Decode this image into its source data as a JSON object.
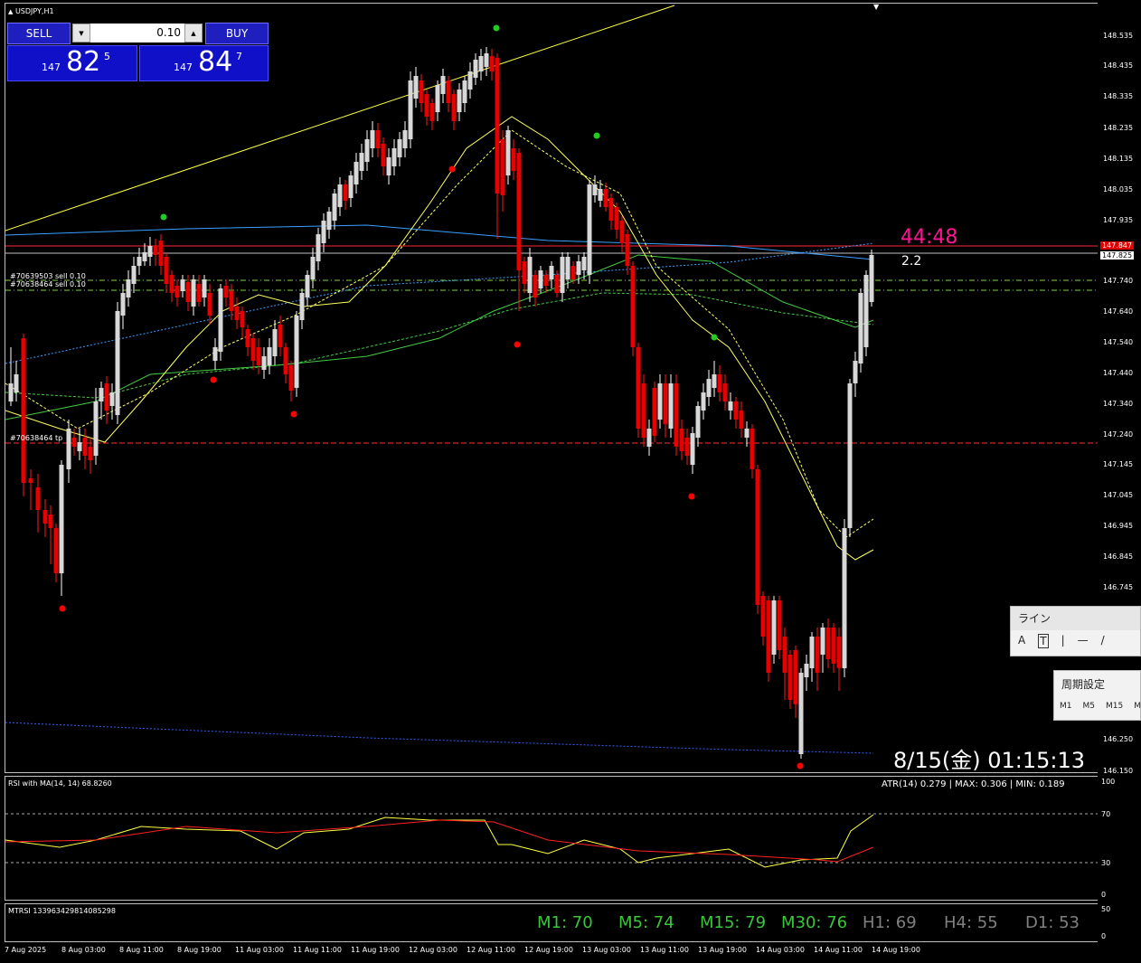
{
  "chart_title": "USDJPY,H1",
  "trade_panel": {
    "sell_label": "SELL",
    "buy_label": "BUY",
    "lot": "0.10",
    "sell_price_prefix": "147",
    "sell_price_big": "82",
    "sell_price_sup": "5",
    "buy_price_prefix": "147",
    "buy_price_big": "84",
    "buy_price_sup": "7"
  },
  "price_axis": [
    "148.535",
    "148.435",
    "148.335",
    "148.235",
    "148.135",
    "148.035",
    "147.935",
    "147.825",
    "147.740",
    "147.640",
    "147.540",
    "147.440",
    "147.340",
    "147.240",
    "147.145",
    "147.045",
    "146.945",
    "146.845",
    "146.745",
    "146.250",
    "146.150"
  ],
  "current_price_label": "147.825",
  "red_price_label": "147.847",
  "orders": {
    "sell1": "#70639503 sell 0.10",
    "sell2": "#70638464 sell 0.10",
    "tp": "#70638464 tp"
  },
  "countdown": "44:48",
  "spread": "2.2",
  "datetime": "8/15(金) 01:15:13",
  "rsi_panel": {
    "title": "RSI with MA(14, 14) 68.8260",
    "atr": "ATR(14) 0.279 | MAX: 0.306 | MIN: 0.189",
    "levels": [
      "100",
      "70",
      "30",
      "0"
    ]
  },
  "mtrsi_panel": {
    "title": "MTRSI 1339634298140852​98",
    "levels": [
      "50",
      "0"
    ],
    "items": [
      {
        "label": "M1: 70",
        "color": "#39c639"
      },
      {
        "label": "M5: 74",
        "color": "#39c639"
      },
      {
        "label": "M15: 79",
        "color": "#39c639"
      },
      {
        "label": "M30: 76",
        "color": "#39c639"
      },
      {
        "label": "H1: 69",
        "color": "#808080"
      },
      {
        "label": "H4: 55",
        "color": "#808080"
      },
      {
        "label": "D1: 53",
        "color": "#808080"
      }
    ]
  },
  "time_axis": [
    "7 Aug 2025",
    "8 Aug 03:00",
    "8 Aug 11:00",
    "8 Aug 19:00",
    "11 Aug 03:00",
    "11 Aug 11:00",
    "11 Aug 19:00",
    "12 Aug 03:00",
    "12 Aug 11:00",
    "12 Aug 19:00",
    "13 Aug 03:00",
    "13 Aug 11:00",
    "13 Aug 19:00",
    "14 Aug 03:00",
    "14 Aug 11:00",
    "14 Aug 19:00"
  ],
  "line_popup": {
    "title": "ライン",
    "tools": [
      "A",
      "T",
      "|",
      "—",
      "/"
    ]
  },
  "period_popup": {
    "title": "周期設定",
    "items": [
      "M1",
      "M5",
      "M15",
      "M"
    ]
  },
  "colors": {
    "bull": "#ffffff",
    "bear": "#ff0000",
    "countdown": "#ff1493",
    "ma_yellow": "#ffff66",
    "ma_green": "#44cc44",
    "ma_blue": "#3aa0ff",
    "rsi": "#ffff44",
    "rsi_ma": "#ff2020"
  }
}
